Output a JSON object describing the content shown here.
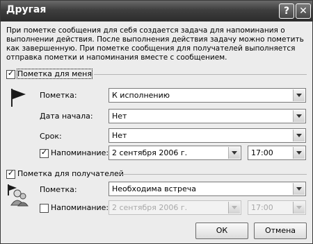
{
  "window": {
    "title": "Другая",
    "help_label": "?",
    "close_label": "✕"
  },
  "description": "При пометке сообщения для себя создается задача для напоминания о выполнении действия. После выполнения действия задачу можно пометить как завершенную. При пометке сообщения для получателей выполняется отправка пометки и напоминания вместе с сообщением.",
  "self_flag": {
    "checked": true,
    "label": "Пометка для меня",
    "icon": "flag-icon",
    "flag_label": "Пометка:",
    "flag_value": "К исполнению",
    "start_label": "Дата начала:",
    "start_value": "Нет",
    "due_label": "Срок:",
    "due_value": "Нет",
    "reminder_checked": true,
    "reminder_label": "Напоминание:",
    "reminder_date": "2 сентября 2006 г.",
    "reminder_time": "17:00"
  },
  "recipients_flag": {
    "checked": true,
    "label": "Пометка для получателей",
    "icon": "recipient-flag-icon",
    "flag_label": "Пометка:",
    "flag_value": "Необходима встреча",
    "reminder_checked": false,
    "reminder_label": "Напоминание:",
    "reminder_date": "2 сентября 2006 г.",
    "reminder_time": "17:00"
  },
  "buttons": {
    "ok": "ОК",
    "cancel": "Отмена"
  }
}
